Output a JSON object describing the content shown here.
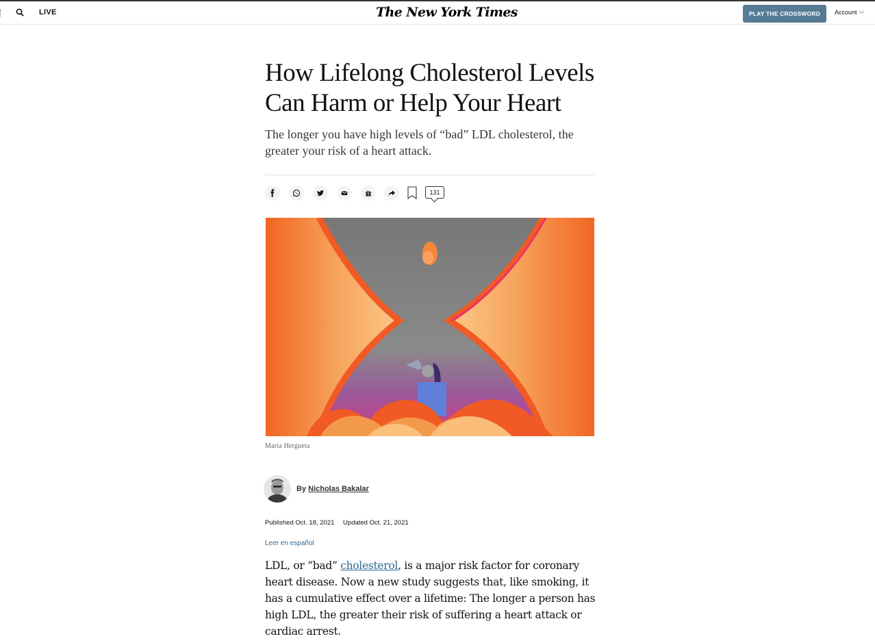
{
  "header": {
    "live_label": "LIVE",
    "masthead": "The New York Times",
    "crossword_button": "PLAY THE CROSSWORD",
    "account_label": "Account"
  },
  "article": {
    "headline_line1": "How Lifelong Cholesterol Levels",
    "headline_line2": "Can Harm or Help Your Heart",
    "summary": "The longer you have high levels of “bad” LDL cholesterol, the greater your risk of a heart attack.",
    "comment_count": "131",
    "image_caption": "Maria Hergueta",
    "byline_prefix": "By",
    "author": "Nicholas Bakalar",
    "published": "Published Oct. 18, 2021",
    "updated": "Updated Oct. 21, 2021",
    "spanish_link": "Leer en español",
    "body_before_link": "LDL, or “bad” ",
    "body_link": "cholesterol",
    "body_after_link": ", is a major risk factor for coronary heart disease. Now a new study suggests that, like smoking, it has a cumulative effect over a lifetime: The longer a person has high LDL, the greater their risk of suffering a heart attack or cardiac arrest."
  },
  "share_icons": [
    "facebook-icon",
    "whatsapp-icon",
    "twitter-icon",
    "email-icon",
    "gift-icon",
    "share-arrow-icon",
    "bookmark-icon",
    "comments-icon"
  ],
  "colors": {
    "crossword_button_bg": "#567b95",
    "link_blue": "#326891",
    "hero_orange": "#f15a24",
    "hero_peach": "#fbbd7a",
    "hero_gray": "#7a7a7a"
  }
}
